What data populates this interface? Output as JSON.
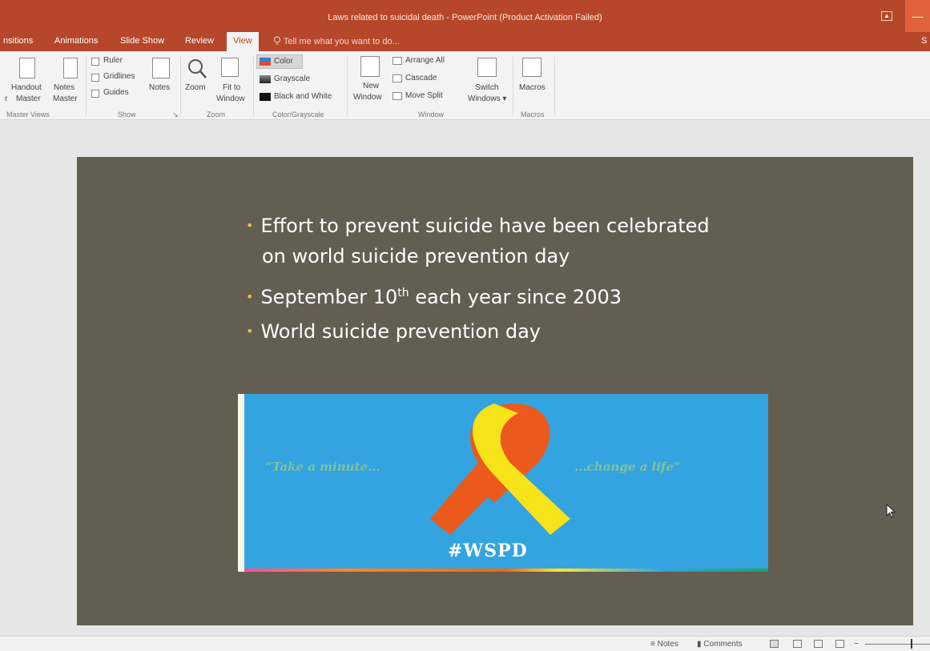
{
  "window": {
    "title": "Laws related to suicidal death - PowerPoint (Product Activation Failed)",
    "restore_icon": "restore-icon",
    "minimize_glyph": "—"
  },
  "tabs": [
    {
      "label": "nsitions"
    },
    {
      "label": "Animations"
    },
    {
      "label": "Slide Show"
    },
    {
      "label": "Review"
    },
    {
      "label": "View"
    },
    {
      "label": "Tell me what you want to do..."
    },
    {
      "label": "S"
    }
  ],
  "ribbon": {
    "master_views": {
      "handout": "Handout",
      "notes": "Notes",
      "master_prefix": "r",
      "master": "Master",
      "group": "Master Views"
    },
    "show": {
      "ruler": "Ruler",
      "gridlines": "Gridlines",
      "guides": "Guides",
      "notes": "Notes",
      "group": "Show",
      "launcher": "↘"
    },
    "zoom": {
      "zoom": "Zoom",
      "fit_to": "Fit to",
      "window": "Window",
      "group": "Zoom"
    },
    "color": {
      "color": "Color",
      "grayscale": "Grayscale",
      "bw": "Black and White",
      "group": "Color/Grayscale"
    },
    "window": {
      "new": "New",
      "new_window": "Window",
      "arrange_all": "Arrange All",
      "cascade": "Cascade",
      "move_split": "Move Split",
      "switch": "Switch",
      "windows": "Windows",
      "group": "Window"
    },
    "macros": {
      "macros": "Macros",
      "group": "Macros"
    }
  },
  "slide": {
    "bullet1_line1": "Effort to prevent suicide have been celebrated",
    "bullet1_line2": "on world suicide prevention day",
    "bullet2_pre": "September 10",
    "bullet2_sup": "th",
    "bullet2_post": " each year since 2003",
    "bullet3": "World suicide prevention day",
    "bullet_glyph": "•",
    "banner": {
      "quote_left": "“Take a minute...",
      "quote_right": "...change a life”",
      "hashtag": "#WSPD",
      "ribbon_orange": "#eb5a1c",
      "ribbon_yellow": "#f7e31a",
      "background": "#33a4e0"
    }
  },
  "status": {
    "notes": "Notes",
    "comments": "Comments"
  },
  "colors": {
    "accent": "#b7472a",
    "slide_background": "#645d51"
  }
}
